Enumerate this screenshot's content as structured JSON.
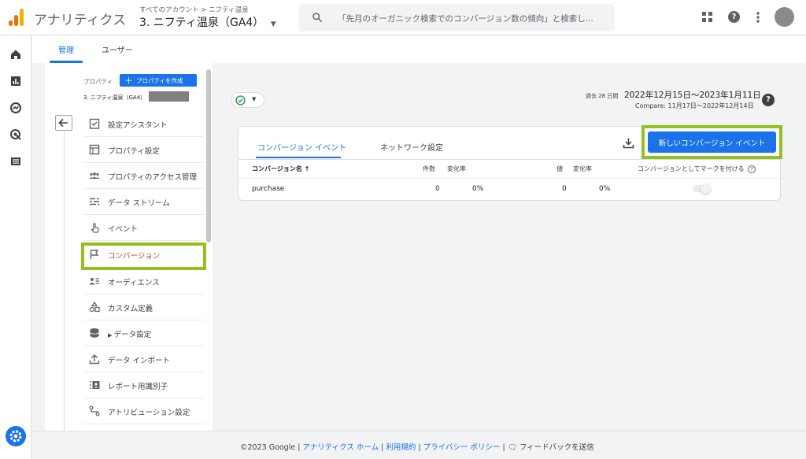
{
  "header": {
    "app_name": "アナリティクス",
    "breadcrumb": "すべてのアカウント > ニフティ温泉",
    "property_title": "3. ニフティ温泉（GA4）",
    "search_placeholder": "「先月のオーガニック検索でのコンバージョン数の傾向」と検索し...",
    "icons": [
      "apps-grid-icon",
      "help-icon",
      "more-vert-icon",
      "account-avatar"
    ],
    "logo_colors": [
      "#f9ab00",
      "#e37400",
      "#e37400"
    ]
  },
  "rail": {
    "icons": [
      "home-icon",
      "reports-icon",
      "explore-icon",
      "advertising-icon",
      "list-icon",
      "admin-gear-icon"
    ]
  },
  "tabs": [
    {
      "label": "管理",
      "active": true
    },
    {
      "label": "ユーザー",
      "active": false
    }
  ],
  "admin_nav": {
    "property_label": "プロパティ",
    "create_property_label": "プロパティを作成",
    "property_name": "3. ニフティ温泉（GA4）",
    "items": [
      {
        "label": "設定アシスタント",
        "icon": "checklist-icon"
      },
      {
        "label": "プロパティ設定",
        "icon": "property-settings-icon"
      },
      {
        "label": "プロパティのアクセス管理",
        "icon": "people-icon"
      },
      {
        "label": "データ ストリーム",
        "icon": "data-streams-icon"
      },
      {
        "label": "イベント",
        "icon": "touch-icon"
      },
      {
        "label": "コンバージョン",
        "icon": "flag-icon",
        "active": true
      },
      {
        "label": "オーディエンス",
        "icon": "audience-icon"
      },
      {
        "label": "カスタム定義",
        "icon": "shapes-icon"
      },
      {
        "label": "データ設定",
        "icon": "database-icon"
      },
      {
        "label": "データ インポート",
        "icon": "upload-icon"
      },
      {
        "label": "レポート用識別子",
        "icon": "id-icon"
      },
      {
        "label": "アトリビューション設定",
        "icon": "attribution-icon"
      }
    ]
  },
  "date": {
    "period_badge": "過去 28 日間",
    "range": "2022年12月15日〜2023年1月11日",
    "compare": "Compare: 11月17日〜2022年12月14日"
  },
  "card": {
    "tabs": [
      "コンバージョン イベント",
      "ネットワーク設定"
    ],
    "new_button_label": "新しいコンバージョン イベント",
    "columns": [
      "コンバージョン名 ↑",
      "件数",
      "変化率",
      "値",
      "変化率",
      "コンバージョンとしてマークを付ける"
    ],
    "rows": [
      {
        "name": "purchase",
        "count": "0",
        "count_change": "0%",
        "value": "0",
        "value_change": "0%",
        "marked": false
      }
    ]
  },
  "footer": {
    "copyright": "©2023 Google |",
    "links": [
      "アナリティクス ホーム",
      "利用規約",
      "プライバシー ポリシー"
    ],
    "feedback": "フィードバックを送信"
  },
  "colors": {
    "accent": "#1a73e8",
    "highlight": "#93c01f",
    "active_nav": "#d93025"
  }
}
